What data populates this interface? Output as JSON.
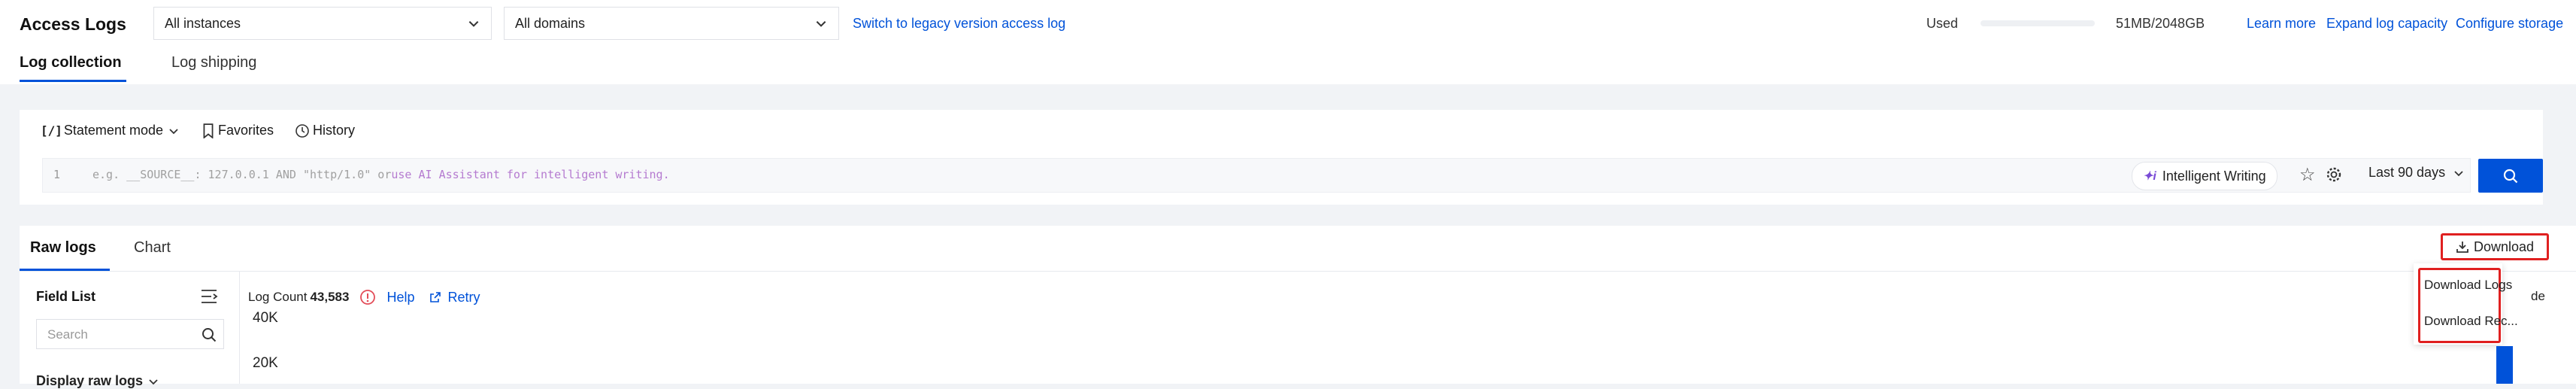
{
  "header": {
    "title": "Access Logs",
    "instance_select": "All instances",
    "domain_select": "All domains",
    "legacy_link": "Switch to legacy version access log",
    "used_label": "Used",
    "used_value": "51MB/2048GB",
    "used_fraction": 2e-05,
    "learn_more": "Learn more",
    "expand_capacity": "Expand log capacity",
    "configure_storage": "Configure storage"
  },
  "main_tabs": [
    {
      "label": "Log collection",
      "active": true
    },
    {
      "label": "Log shipping",
      "active": false
    }
  ],
  "query": {
    "mode_label": "Statement mode",
    "favorites": "Favorites",
    "history": "History",
    "line_number": "1",
    "placeholder_a": "e.g. __SOURCE__: 127.0.0.1 AND \"http/1.0\" or",
    "placeholder_b": "use AI Assistant for intelligent writing.",
    "ai_button": "Intelligent Writing",
    "time_range": "Last 90 days"
  },
  "result_tabs": [
    {
      "label": "Raw logs",
      "active": true
    },
    {
      "label": "Chart",
      "active": false
    }
  ],
  "download": {
    "button": "Download",
    "menu": [
      "Download Logs",
      "Download Rec..."
    ]
  },
  "field_list": {
    "title": "Field List",
    "search_placeholder": "Search",
    "display_raw": "Display raw logs"
  },
  "histogram": {
    "count_label": "Log Count",
    "count_value": "43,583",
    "help": "Help",
    "retry": "Retry",
    "ticks": [
      "40K",
      "20K"
    ],
    "cut_label": "de"
  },
  "colors": {
    "accent": "#0052d9",
    "highlight": "#e02020",
    "warning": "#e34d59"
  }
}
